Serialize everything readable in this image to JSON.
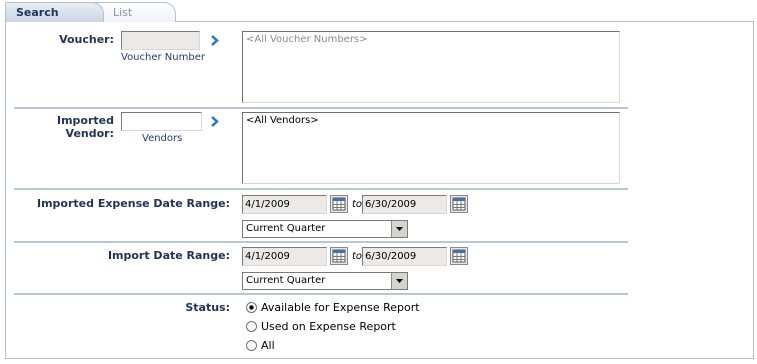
{
  "tabs": {
    "search": "Search",
    "list": "List"
  },
  "voucher": {
    "label": "Voucher:",
    "sublink": "Voucher Number",
    "list_value": "<All Voucher Numbers>"
  },
  "vendor": {
    "label": "Imported Vendor:",
    "sublink": "Vendors",
    "list_value": "<All Vendors>"
  },
  "expense_range": {
    "label": "Imported Expense Date Range:",
    "from": "4/1/2009",
    "to_label": "to",
    "to": "6/30/2009",
    "period": "Current Quarter"
  },
  "import_range": {
    "label": "Import Date Range:",
    "from": "4/1/2009",
    "to_label": "to",
    "to": "6/30/2009",
    "period": "Current Quarter"
  },
  "status": {
    "label": "Status:",
    "options": [
      {
        "label": "Available for Expense Report",
        "selected": true
      },
      {
        "label": "Used on Expense Report",
        "selected": false
      },
      {
        "label": "All",
        "selected": false
      }
    ]
  },
  "colors": {
    "label_color": "#1f3358",
    "separator": "#b9c6d7",
    "arrow": "#2f6fd0"
  }
}
